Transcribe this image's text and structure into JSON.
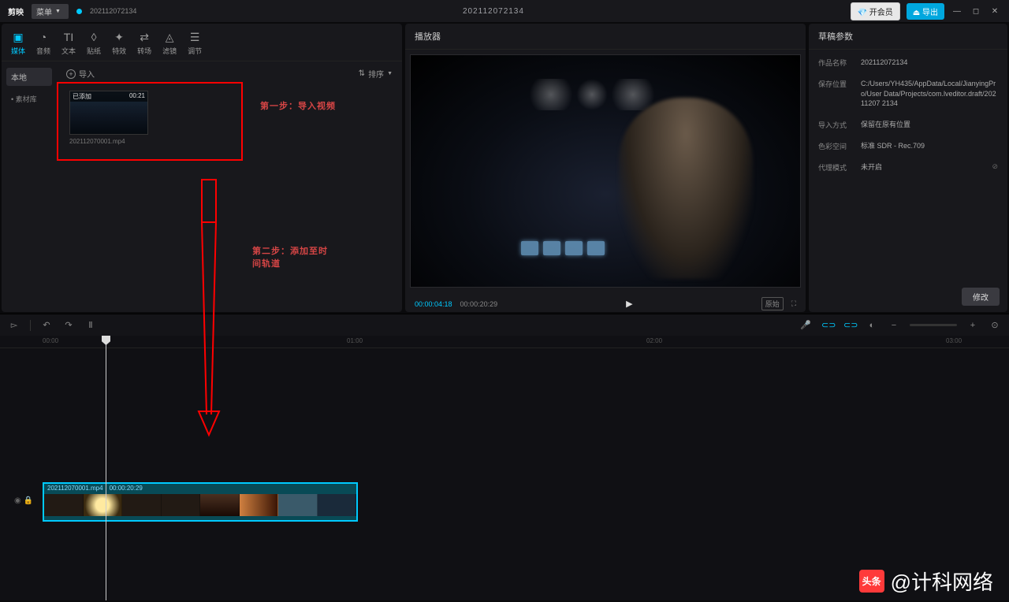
{
  "topbar": {
    "logo": "剪映",
    "menu": "菜单",
    "project_name": "202112072134",
    "center_title": "202112072134",
    "btn_vip": "开会员",
    "btn_export": "导出"
  },
  "tabs": {
    "items": [
      {
        "label": "媒体",
        "active": true
      },
      {
        "label": "音频"
      },
      {
        "label": "文本"
      },
      {
        "label": "贴纸"
      },
      {
        "label": "特效"
      },
      {
        "label": "转场"
      },
      {
        "label": "滤镜"
      },
      {
        "label": "调节"
      }
    ]
  },
  "sidebar": {
    "cat_local": "本地",
    "cat_library": "素材库"
  },
  "media": {
    "import_label": "导入",
    "sort_label": "排序",
    "clip": {
      "badge": "已添加",
      "duration": "00:21",
      "filename": "202112070001.mp4"
    }
  },
  "annotations": {
    "step1": "第一步：导入视频",
    "step2": "第二步：添加至时间轨道"
  },
  "preview": {
    "title": "播放器",
    "time_current": "00:00:04:18",
    "time_total": "00:00:20:29",
    "ratio": "原始"
  },
  "props": {
    "title": "草稿参数",
    "rows": {
      "name_lbl": "作品名称",
      "name_val": "202112072134",
      "path_lbl": "保存位置",
      "path_val": "C:/Users/YH435/AppData/Local/JianyingPro/User Data/Projects/com.lveditor.draft/20211207 2134",
      "import_lbl": "导入方式",
      "import_val": "保留在原有位置",
      "color_lbl": "色彩空间",
      "color_val": "标准 SDR - Rec.709",
      "proxy_lbl": "代理模式",
      "proxy_val": "未开启"
    },
    "btn_edit": "修改"
  },
  "timeline": {
    "clip_name": "202112070001.mp4",
    "clip_dur": "00:00:20:29",
    "ticks": [
      "00:00",
      "01:00",
      "02:00",
      "03:00"
    ]
  },
  "watermark": {
    "logo": "头条",
    "text": "@计科网络"
  }
}
